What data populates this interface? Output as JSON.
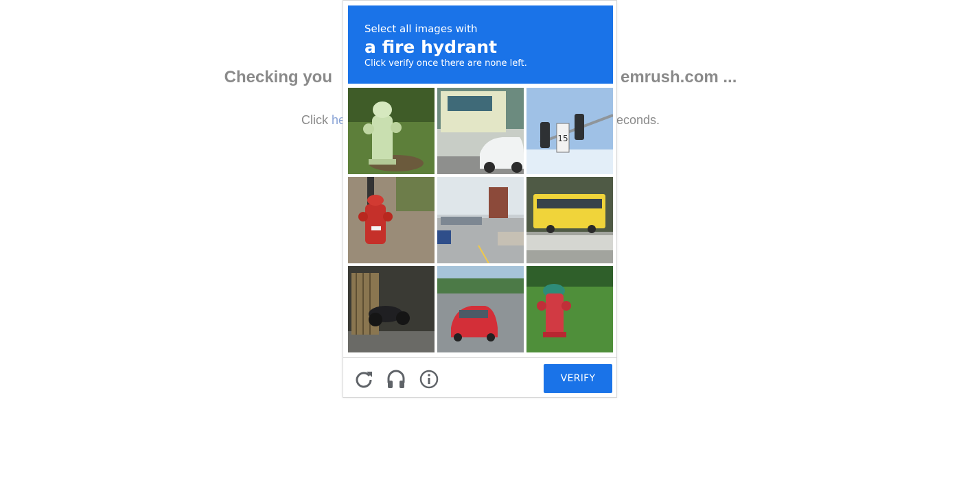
{
  "background": {
    "heading_left": "Checking you",
    "heading_right": "emrush.com ...",
    "sub_prefix": "Click ",
    "sub_link": "he",
    "sub_suffix": "econds."
  },
  "captcha": {
    "instruction": "Select all images with",
    "target": "a fire hydrant",
    "hint": "Click verify once there are none left.",
    "tiles": [
      {
        "content": "green fire hydrant on grass"
      },
      {
        "content": "bus and white car on street"
      },
      {
        "content": "traffic lights with speed sign 15"
      },
      {
        "content": "red fire hydrant by pole"
      },
      {
        "content": "city street with cars and buildings"
      },
      {
        "content": "yellow bus on highway"
      },
      {
        "content": "motorcycle parked by bamboo fence"
      },
      {
        "content": "red car on tree-lined road"
      },
      {
        "content": "red and green fire hydrant on grass"
      }
    ],
    "verify_label": "VERIFY",
    "icons": [
      "reload-icon",
      "headphones-icon",
      "info-icon"
    ],
    "accent_color": "#1a73e8"
  }
}
